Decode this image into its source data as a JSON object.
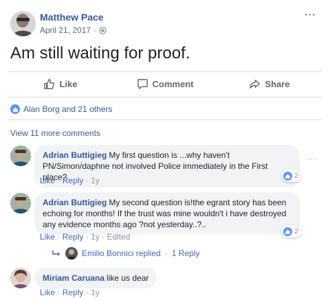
{
  "post": {
    "author": "Matthew Pace",
    "date": "April 21, 2017",
    "separator": "·",
    "text": "Am still waiting for proof.",
    "more_icon": "···"
  },
  "actions": {
    "like": "Like",
    "comment": "Comment",
    "share": "Share"
  },
  "reactions": {
    "summary": "Alan Borg and 21 others"
  },
  "view_more": "View 11 more comments",
  "comments": [
    {
      "author": "Adrian Buttigieg",
      "text": "My first question is ...why haven't PN/Simon/daphne not involved Police immediately in the First place?",
      "like": "Like",
      "reply": "Reply",
      "time": "1y",
      "edited": "",
      "reactions": "2",
      "more_icon": "···"
    },
    {
      "author": "Adrian Buttigieg",
      "text": "My second question is!the egrant story has been echoing for months! If the trust was mine wouldn't i have destroyed any evidence months ago ?not yesterday..?..",
      "like": "Like",
      "reply": "Reply",
      "time": "1y",
      "edited": "Edited",
      "reactions": "2"
    },
    {
      "author": "Miriam Caruana",
      "text": "like us dear",
      "like": "Like",
      "reply": "Reply",
      "time": "1y"
    }
  ],
  "reply_thread": {
    "text": "Emilio Bonnici replied",
    "count": "1 Reply"
  },
  "dot": "·",
  "colors": {
    "link": "#365899",
    "action_gray": "#606770",
    "bubble": "#f2f3f5",
    "like_blue": "#5890ff"
  }
}
